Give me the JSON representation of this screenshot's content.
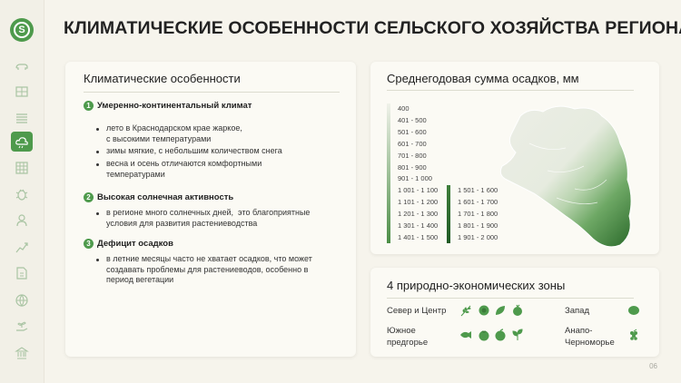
{
  "header": {
    "title": "КЛИМАТИЧЕСКИЕ ОСОБЕННОСТИ СЕЛЬСКОГО ХОЗЯЙСТВА РЕГИОНА"
  },
  "sidebar": {
    "logo_letter": "S",
    "items": [
      {
        "icon": "cow-icon"
      },
      {
        "icon": "cabinet-icon"
      },
      {
        "icon": "field-icon"
      },
      {
        "icon": "weather-cloud-icon",
        "active": true
      },
      {
        "icon": "table-grid-icon"
      },
      {
        "icon": "bug-icon"
      },
      {
        "icon": "farmer-icon"
      },
      {
        "icon": "growth-chart-icon"
      },
      {
        "icon": "document-money-icon"
      },
      {
        "icon": "globe-icon"
      },
      {
        "icon": "plant-hand-icon"
      },
      {
        "icon": "bank-icon"
      }
    ]
  },
  "climate_card": {
    "title": "Климатические особенности",
    "sections": [
      {
        "number": "1",
        "title": "Умеренно-континентальный климат",
        "bullets": [
          "лето в Краснодарском крае жаркое,\nс высокими температурами",
          "зимы мягкие, с небольшим количеством снега",
          "весна и осень отличаются комфортными\nтемпературами"
        ]
      },
      {
        "number": "2",
        "title": "Высокая солнечная активность",
        "bullets": [
          "в регионе много солнечных дней,  это благоприятные\nусловия для развития растениеводства"
        ]
      },
      {
        "number": "3",
        "title": "Дефицит осадков",
        "bullets": [
          "в летние месяцы часто не хватает осадков, что может\nсоздавать проблемы для растениеводов, особенно в\nпериод вегетации"
        ]
      }
    ]
  },
  "precip_card": {
    "title": "Среднегодовая сумма осадков, мм",
    "legend_col1": [
      "400",
      "401 - 500",
      "501 - 600",
      "601 - 700",
      "701 - 800",
      "801 - 900",
      "901 - 1 000",
      "1 001 - 1 100",
      "1 101 - 1 200",
      "1 201 - 1 300",
      "1 301 - 1 400",
      "1 401 - 1 500"
    ],
    "legend_col2": [
      "1 501 - 1 600",
      "1 601 - 1 700",
      "1 701 - 1 800",
      "1 801 - 1 900",
      "1 901 - 2 000"
    ]
  },
  "zones_card": {
    "title": "4 природно-экономических зоны",
    "zones": [
      {
        "label": "Север и Центр",
        "icons": [
          "wheat-icon",
          "sunflower-icon",
          "leaf-icon",
          "beet-icon"
        ]
      },
      {
        "label": "Запад",
        "icons": [
          "rice-grain-icon"
        ]
      },
      {
        "label": "Южное\nпредгорье",
        "icons": [
          "fish-icon",
          "tomato-icon",
          "apple-icon",
          "herb-icon"
        ]
      },
      {
        "label": "Анапо-\nЧерноморье",
        "icons": [
          "grapes-icon"
        ]
      }
    ]
  },
  "colors": {
    "accent": "#4e9a4c",
    "background": "#f6f4ec",
    "card": "#fbfaf4"
  },
  "footer": {
    "page_number": "06"
  }
}
